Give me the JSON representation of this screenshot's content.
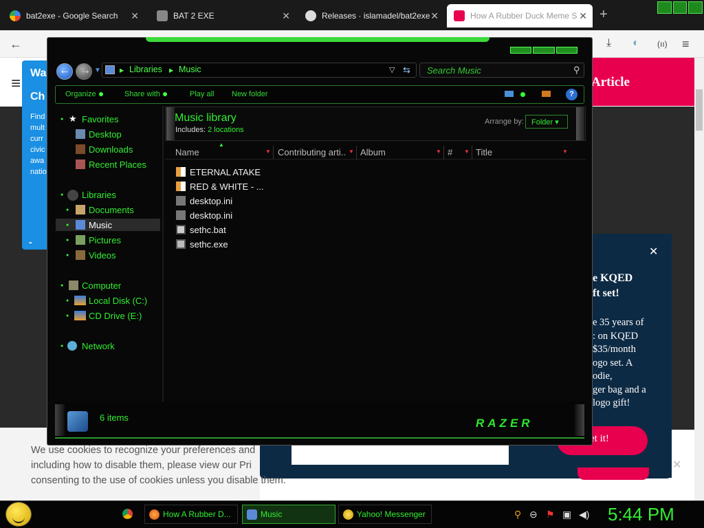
{
  "browser": {
    "tabs": [
      {
        "title": "bat2exe - Google Search",
        "icon": "google-icon"
      },
      {
        "title": "BAT 2 EXE",
        "icon": "page-icon"
      },
      {
        "title": "Releases · islamadel/bat2exe",
        "icon": "github-icon"
      },
      {
        "title": "How A Rubber Duck Meme S",
        "icon": "kqed-icon",
        "active": true
      }
    ],
    "new_tab": "+",
    "close_glyph": "✕"
  },
  "webpage": {
    "left_card": {
      "t1": "Wa",
      "t2": "Ch",
      "t3": "Find mult curr civic awa natio",
      "t4": "-"
    },
    "banner": "Article",
    "promo": {
      "close": "✕",
      "heading": "e KQED\nft set!",
      "text": "e 35 years of\n: on KQED\n$35/month\nogo set. A\nodie,\nger bag and a\nlogo gift!",
      "button": "et it!"
    },
    "cookie": {
      "line1": "We use cookies to recognize your preferences and",
      "line2": "including how to disable them, please view our Pri",
      "line3": "consenting to the use of cookies unless you disable them."
    }
  },
  "explorer": {
    "address": {
      "crumbs": [
        "Libraries",
        "Music"
      ]
    },
    "search_placeholder": "Search Music",
    "toolbar": {
      "organize": "Organize",
      "share": "Share with",
      "play_all": "Play all",
      "new_folder": "New folder",
      "help": "?"
    },
    "nav": {
      "favorites": "Favorites",
      "desktop": "Desktop",
      "downloads": "Downloads",
      "recent": "Recent Places",
      "libraries": "Libraries",
      "documents": "Documents",
      "music": "Music",
      "pictures": "Pictures",
      "videos": "Videos",
      "computer": "Computer",
      "local_disk": "Local Disk (C:)",
      "cd_drive": "CD Drive (E:)",
      "network": "Network"
    },
    "library": {
      "title": "Music library",
      "includes_label": "Includes:",
      "locations": "2 locations",
      "arrange_label": "Arrange by:",
      "arrange_value": "Folder ▾"
    },
    "columns": [
      "Name",
      "Contributing arti...",
      "Album",
      "#",
      "Title"
    ],
    "files": [
      {
        "name": "ETERNAL ATAKE",
        "icon": "folder-icon"
      },
      {
        "name": "RED & WHITE - ...",
        "icon": "folder-icon"
      },
      {
        "name": "desktop.ini",
        "icon": "settings-file-icon"
      },
      {
        "name": "desktop.ini",
        "icon": "settings-file-icon"
      },
      {
        "name": "sethc.bat",
        "icon": "batch-file-icon"
      },
      {
        "name": "sethc.exe",
        "icon": "exe-file-icon"
      }
    ],
    "status": "6 items",
    "brand": "RAZER",
    "colors": {
      "accent": "#33ee33",
      "background": "#080808"
    }
  },
  "taskbar": {
    "items": [
      {
        "label": "How A Rubber D...",
        "icon": "firefox-icon"
      },
      {
        "label": "Music",
        "icon": "explorer-icon",
        "active": true
      },
      {
        "label": "Yahoo! Messenger",
        "icon": "yahoo-messenger-icon"
      }
    ],
    "clock": "5:44 PM"
  }
}
